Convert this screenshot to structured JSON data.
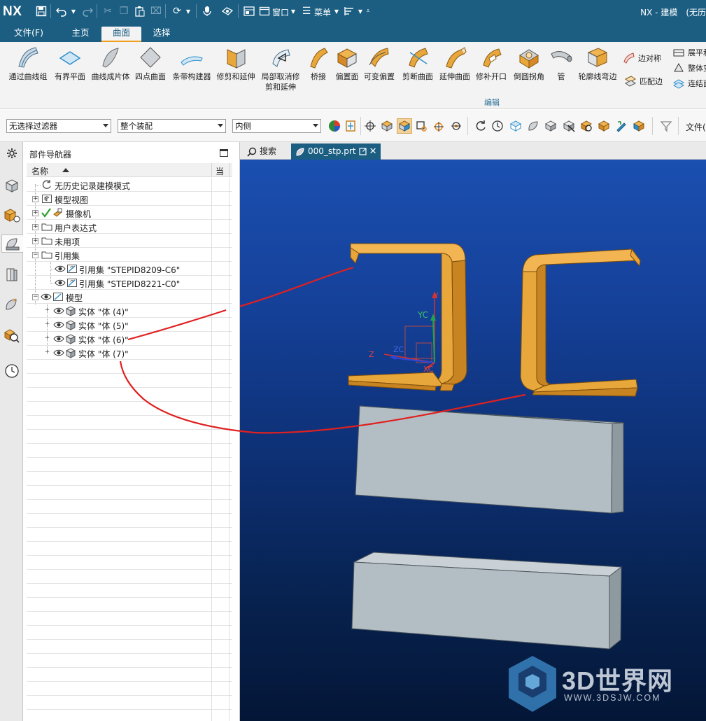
{
  "titlebar": {
    "logo": "NX",
    "window_label": "窗口",
    "menu_label": "菜单",
    "app_title": "NX - 建模　(无历"
  },
  "menu_tabs": [
    {
      "label": "文件(F)",
      "active": false
    },
    {
      "label": "主页",
      "active": false
    },
    {
      "label": "曲面",
      "active": true
    },
    {
      "label": "选择",
      "active": false
    }
  ],
  "ribbon": {
    "tools": [
      {
        "label": "通过曲线组",
        "icon": "through-curves-icon"
      },
      {
        "label": "有界平面",
        "icon": "bounded-plane-icon"
      },
      {
        "label": "曲线成片体",
        "icon": "curve-to-sheet-icon"
      },
      {
        "label": "四点曲面",
        "icon": "four-point-surface-icon"
      },
      {
        "label": "条带构建器",
        "icon": "strip-builder-icon"
      },
      {
        "label": "修剪和延伸",
        "icon": "trim-extend-icon"
      },
      {
        "label": "局部取消修剪和延伸",
        "icon": "local-untrim-icon"
      },
      {
        "label": "桥接",
        "icon": "bridge-icon"
      },
      {
        "label": "偏置面",
        "icon": "offset-face-icon"
      },
      {
        "label": "可变偏置",
        "icon": "variable-offset-icon"
      },
      {
        "label": "剪断曲面",
        "icon": "divide-surface-icon"
      },
      {
        "label": "延伸曲面",
        "icon": "extend-surface-icon"
      },
      {
        "label": "修补开口",
        "icon": "patch-opening-icon"
      },
      {
        "label": "倒圆拐角",
        "icon": "corner-blend-icon"
      },
      {
        "label": "管",
        "icon": "tube-icon"
      },
      {
        "label": "轮廓线弯边",
        "icon": "profile-flange-icon"
      }
    ],
    "small_tools": [
      {
        "label": "边对称",
        "icon": "edge-symmetry-icon"
      },
      {
        "label": "匹配边",
        "icon": "match-edge-icon"
      },
      {
        "label": "展平和",
        "icon": "flatten-icon"
      },
      {
        "label": "整体变",
        "icon": "global-shape-icon"
      },
      {
        "label": "连结面",
        "icon": "join-face-icon"
      }
    ],
    "group_label": "编辑"
  },
  "selection_bar": {
    "filter": "无选择过滤器",
    "scope": "整个装配",
    "mode": "内侧",
    "file_label": "文件("
  },
  "navigator": {
    "title": "部件导航器",
    "col_name": "名称",
    "col_current": "当",
    "rows": [
      {
        "label": "无历史记录建模模式",
        "icon": "history-mode-icon"
      },
      {
        "label": "模型视图",
        "icon": "model-views-icon"
      },
      {
        "label": "摄像机",
        "icon": "camera-icon"
      },
      {
        "label": "用户表达式",
        "icon": "folder-icon"
      },
      {
        "label": "未用项",
        "icon": "folder-icon"
      },
      {
        "label": "引用集",
        "icon": "folder-icon"
      },
      {
        "label": "引用集 \"STEPID8209-C6\"",
        "icon": "reference-set-icon"
      },
      {
        "label": "引用集 \"STEPID8221-C0\"",
        "icon": "reference-set-icon"
      },
      {
        "label": "模型",
        "icon": "model-icon"
      },
      {
        "label": "实体 \"体 (4)\"",
        "icon": "solid-body-icon"
      },
      {
        "label": "实体 \"体 (5)\"",
        "icon": "solid-body-icon"
      },
      {
        "label": "实体 \"体 (6)\"",
        "icon": "solid-body-icon"
      },
      {
        "label": "实体 \"体 (7)\"",
        "icon": "solid-body-icon"
      }
    ]
  },
  "doc_tabs": [
    {
      "label": "搜索",
      "active": false
    },
    {
      "label": "000_stp.prt",
      "active": true
    }
  ],
  "viewport": {
    "axis_labels": {
      "y": "Y",
      "yc": "YC",
      "z": "Z",
      "zc": "ZC",
      "xc": "XC"
    },
    "background_top": "#1b4fb0",
    "background_bottom": "#041636",
    "channel_color": "#e8a73b",
    "block_color": "#b3bec4",
    "annotation_color": "#e02020"
  },
  "watermark": {
    "title": "3D世界网",
    "url": "WWW.3DSJW.COM"
  }
}
